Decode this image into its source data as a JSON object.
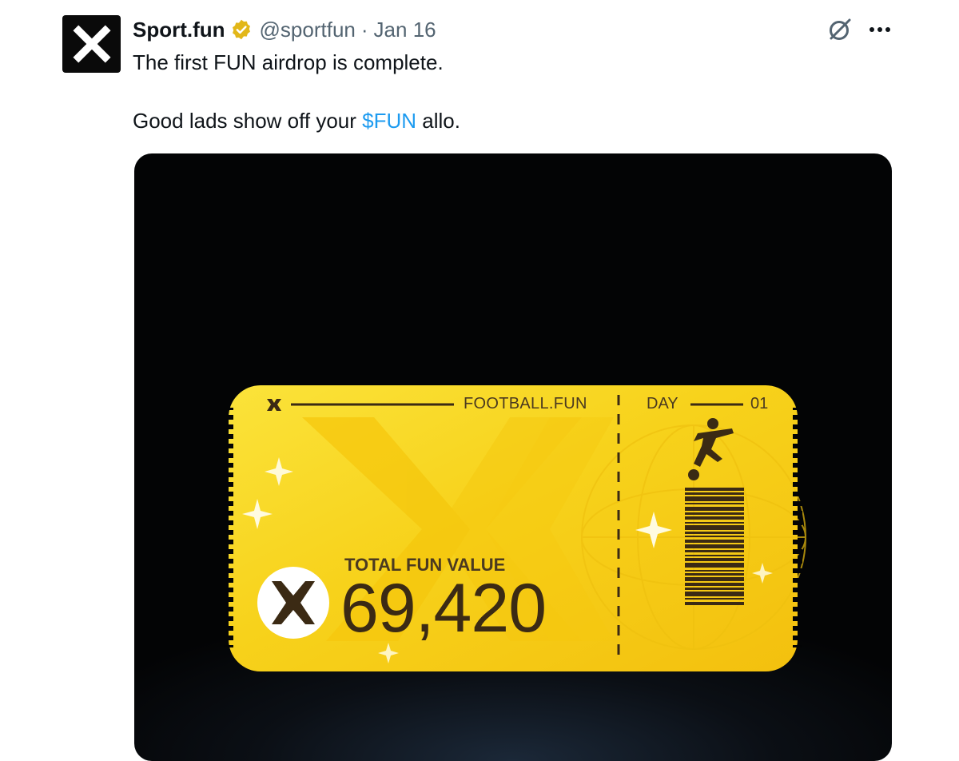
{
  "tweet": {
    "author": {
      "display_name": "Sport.fun",
      "handle": "@sportfun",
      "separator": "·",
      "date": "Jan 16",
      "avatar_icon": "sportfun-x-logo-icon",
      "verified_icon": "verified-gold-badge-icon",
      "verified_color": "#e2b719"
    },
    "actions": {
      "grok_icon": "grok-icon",
      "more_icon": "more-dots-icon"
    },
    "text": {
      "line1": "The first FUN airdrop is complete.",
      "line2_prefix": "Good lads show off your ",
      "cashtag": "$FUN",
      "line2_suffix": " allo."
    },
    "link_color": "#1d9bf0"
  },
  "ticket": {
    "brand": "FOOTBALL.FUN",
    "day_label": "DAY",
    "day_number": "01",
    "total_label": "TOTAL FUN VALUE",
    "total_value": "69,420",
    "icons": [
      "sportfun-logo-icon",
      "football-player-icon",
      "barcode-icon",
      "sparkle-icon"
    ],
    "gold_color": "#f7d21b",
    "ink_color": "#3b2a14"
  },
  "media_background": "#05070a"
}
